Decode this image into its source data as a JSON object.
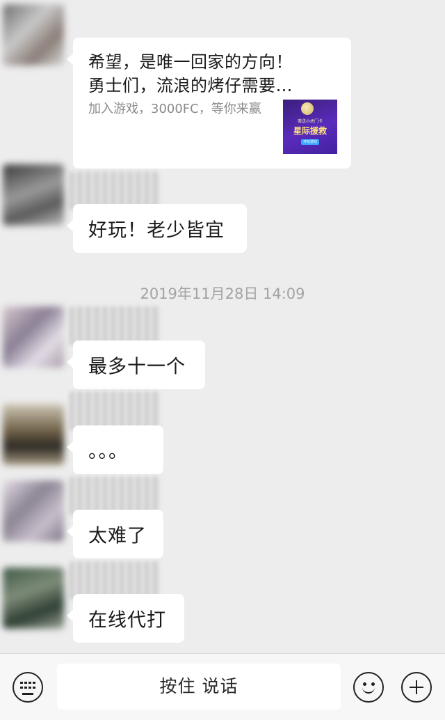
{
  "card_message": {
    "title_line1": "希望，是唯一回家的方向！",
    "title_line2": "勇士们，流浪的烤仔需要…",
    "description": "加入游戏，3000FC，等你来赢",
    "thumbnail": {
      "small_text": "赠送小虎门卡",
      "title": "星际援救",
      "button": "开始游戏"
    }
  },
  "messages": [
    {
      "text": "好玩！老少皆宜"
    },
    {
      "text": "最多十一个"
    },
    {
      "text": "。。。"
    },
    {
      "text": "太难了"
    },
    {
      "text": "在线代打"
    }
  ],
  "timestamp": "2019年11月28日 14:09",
  "input_bar": {
    "hold_to_talk_label": "按住 说话",
    "left_icon": "keyboard-icon",
    "right_icons": [
      "emoji-icon",
      "plus-icon"
    ]
  },
  "colors": {
    "background": "#ededed",
    "bubble": "#ffffff",
    "timestamp_text": "#a3a3a3"
  }
}
